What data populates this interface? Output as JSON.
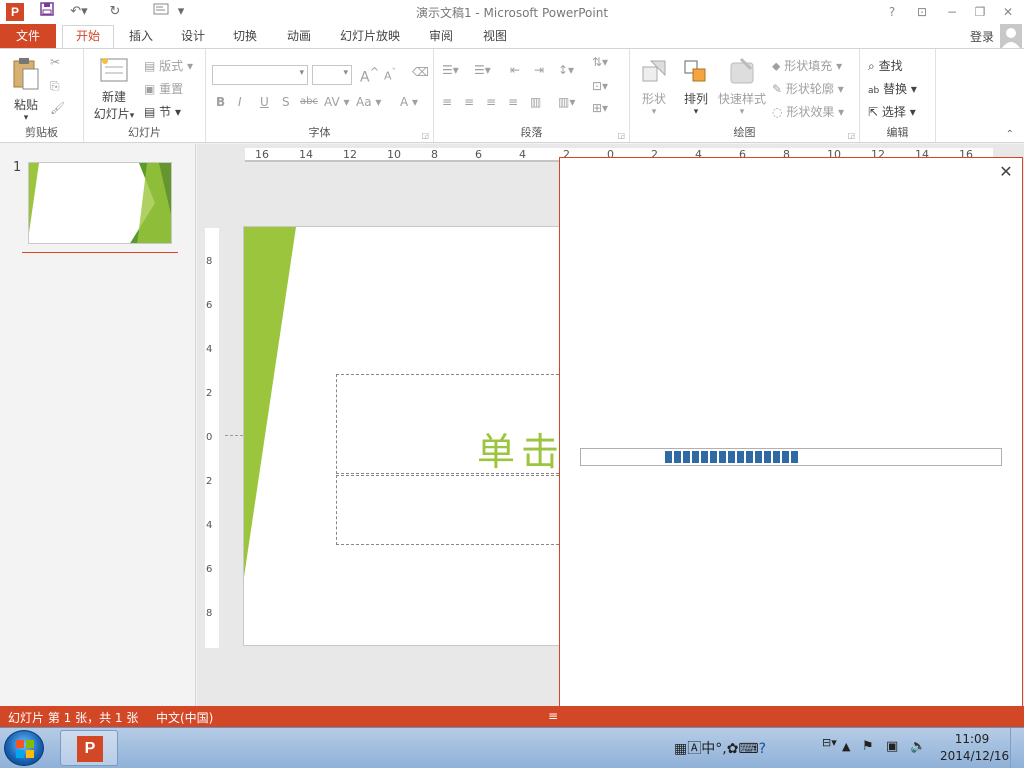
{
  "window": {
    "title": "演示文稿1 - Microsoft PowerPoint",
    "app_icon": "P",
    "help": "?",
    "restore_ribbon": "⊡",
    "minimize": "−",
    "maximize": "❐",
    "close": "✕"
  },
  "qat": {
    "save_icon": "save-icon",
    "undo_icon": "undo-icon",
    "redo_icon": "redo-icon",
    "start_icon": "from-beginning-icon",
    "customize": "▾"
  },
  "tabs": [
    {
      "label": "文件"
    },
    {
      "label": "开始"
    },
    {
      "label": "插入"
    },
    {
      "label": "设计"
    },
    {
      "label": "切换"
    },
    {
      "label": "动画"
    },
    {
      "label": "幻灯片放映"
    },
    {
      "label": "审阅"
    },
    {
      "label": "视图"
    }
  ],
  "login": "登录",
  "ribbon": {
    "clipboard": {
      "label": "剪贴板",
      "paste": "粘贴",
      "cut": "✂",
      "copy": "⎘",
      "format": "🖌"
    },
    "slides": {
      "label": "幻灯片",
      "new_line1": "新建",
      "new_line2": "幻灯片",
      "layout": "版式",
      "reset": "重置",
      "section": "节"
    },
    "font": {
      "label": "字体",
      "bold": "B",
      "italic": "I",
      "underline": "U",
      "shadow": "S",
      "strike": "abc",
      "spacing": "AV",
      "case": "Aa",
      "color": "A",
      "grow": "A",
      "shrink": "A"
    },
    "paragraph": {
      "label": "段落"
    },
    "drawing": {
      "label": "绘图",
      "shapes": "形状",
      "arrange": "排列",
      "quick_styles": "快速样式",
      "fill": "形状填充",
      "outline": "形状轮廓",
      "effects": "形状效果"
    },
    "editing": {
      "label": "编辑",
      "find": "查找",
      "replace": "替换",
      "select": "选择"
    }
  },
  "slides_panel": {
    "number": "1"
  },
  "ruler": {
    "h": [
      "16",
      "14",
      "12",
      "10",
      "8",
      "6",
      "4",
      "2",
      "0",
      "2",
      "4",
      "6",
      "8",
      "10",
      "12",
      "14",
      "16"
    ],
    "v": [
      "8",
      "6",
      "4",
      "2",
      "0",
      "2",
      "4",
      "6",
      "8"
    ]
  },
  "slide": {
    "title_placeholder": "单击"
  },
  "popup": {
    "close": "✕",
    "progress": 0.32
  },
  "status": {
    "slide_info": "幻灯片 第 1 张，共 1 张",
    "language": "中文(中国)"
  },
  "taskbar": {
    "ime": "中",
    "time": "11:09",
    "date": "2014/12/16"
  },
  "colors": {
    "accent": "#d24726",
    "green": "#9bc53d",
    "progress": "#2f6aa5"
  }
}
